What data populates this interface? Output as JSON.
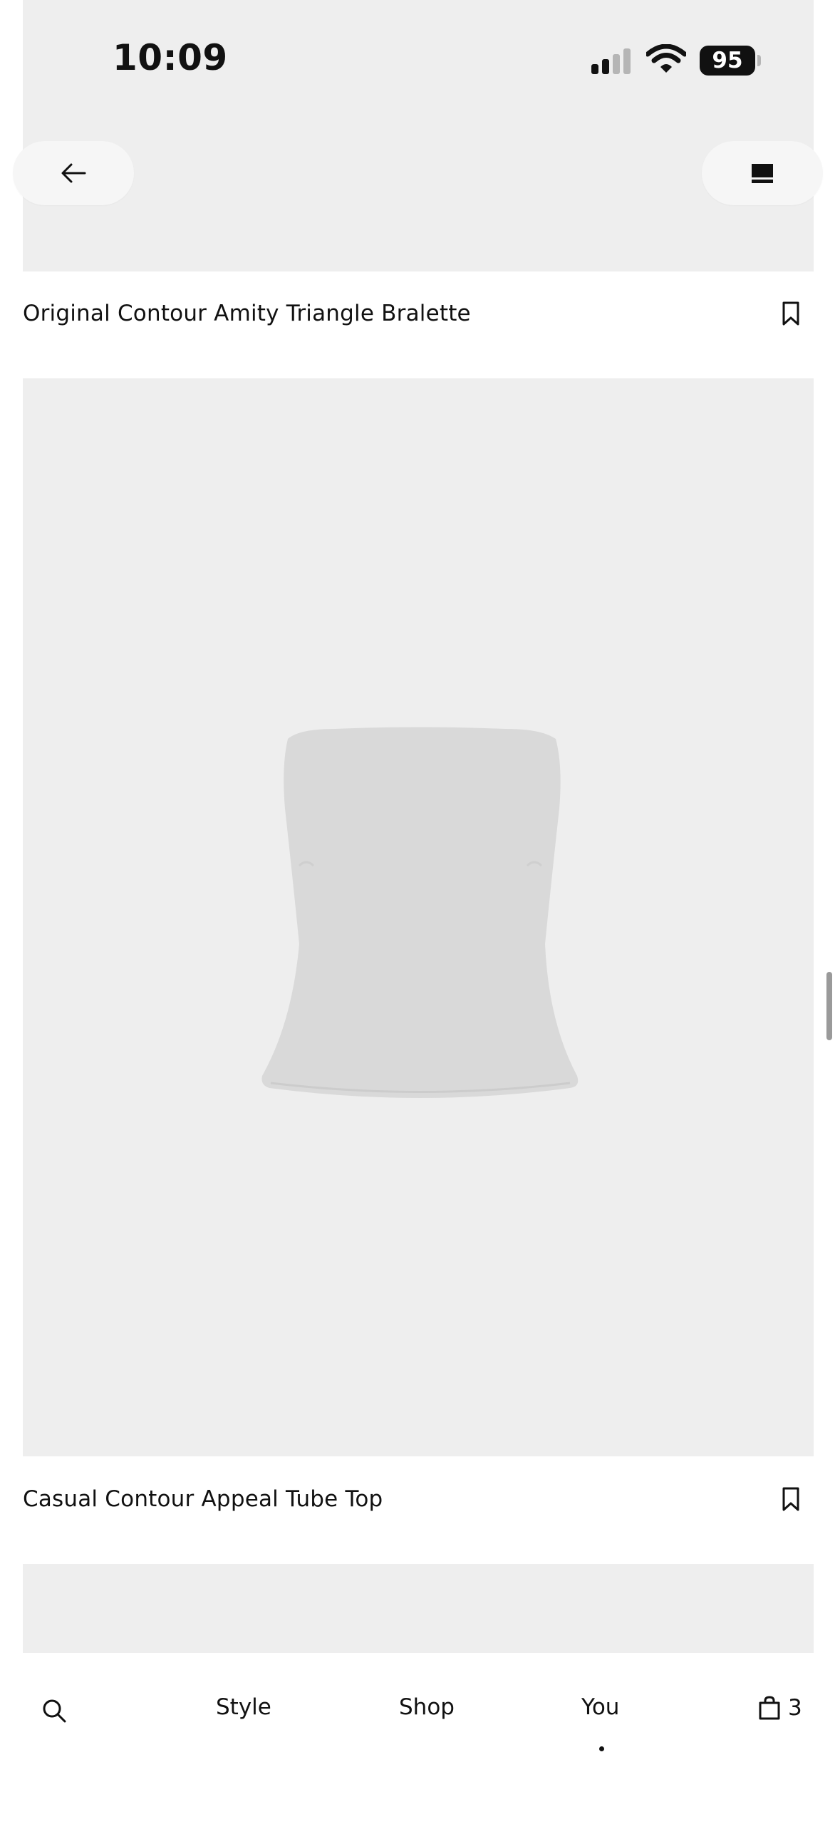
{
  "status_bar": {
    "time": "10:09",
    "battery": "95",
    "icons": [
      "signal-icon",
      "wifi-icon",
      "battery-icon"
    ]
  },
  "top_buttons": {
    "back_icon": "arrow-left-icon",
    "view_icon": "view-toggle-icon"
  },
  "products": [
    {
      "title": "Original Contour Amity Triangle Bralette",
      "bookmark_icon": "bookmark-icon"
    },
    {
      "title": "Casual Contour Appeal Tube Top",
      "bookmark_icon": "bookmark-icon"
    }
  ],
  "bottom_nav": {
    "search_icon": "search-icon",
    "items": [
      {
        "label": "Style"
      },
      {
        "label": "Shop"
      },
      {
        "label": "You"
      }
    ],
    "active_index": 2,
    "bag_icon": "shopping-bag-icon",
    "bag_count": "3"
  },
  "colors": {
    "image_bg": "#eeeeee",
    "pill_bg": "#f6f6f6",
    "text": "#111111",
    "garment": "#d9d9d9"
  }
}
